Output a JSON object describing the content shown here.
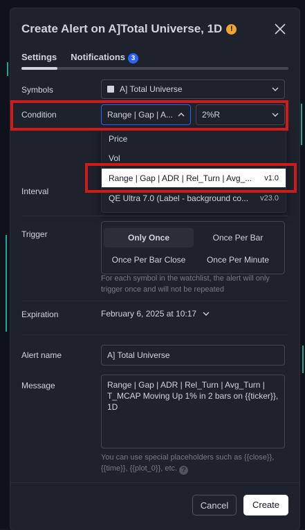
{
  "dialog": {
    "title": "Create Alert on A]Total Universe, 1D",
    "warning_icon": "!"
  },
  "tabs": [
    {
      "label": "Settings",
      "active": true
    },
    {
      "label": "Notifications",
      "badge": "3"
    }
  ],
  "symbols": {
    "label": "Symbols",
    "value": "A] Total Universe"
  },
  "condition": {
    "label": "Condition",
    "value": "Range | Gap | A...",
    "second_value": "2%R"
  },
  "condition_dropdown": {
    "items": [
      {
        "label": "Price"
      },
      {
        "label": "Vol"
      },
      {
        "label": "Range | Gap | ADR | Rel_Turn | Avg_...",
        "version": "v1.0",
        "selected": true
      },
      {
        "label": "QE Ultra 7.0 (Label - background co...",
        "version": "v23.0"
      }
    ]
  },
  "interval": {
    "label": "Interval"
  },
  "trigger": {
    "label": "Trigger",
    "options": [
      "Only Once",
      "Once Per Bar",
      "Once Per Bar Close",
      "Once Per Minute"
    ],
    "selected": "Only Once",
    "hint": "For each symbol in the watchlist, the alert will only trigger once and will not be repeated"
  },
  "expiration": {
    "label": "Expiration",
    "value": "February 6, 2025 at 10:17"
  },
  "alert_name": {
    "label": "Alert name",
    "value": "A] Total Universe"
  },
  "message": {
    "label": "Message",
    "value": "Range | Gap | ADR | Rel_Turn | Avg_Turn |\nT_MCAP Moving Up 1% in 2 bars on {{ticker}},\n1D",
    "hint": "You can use special placeholders such as {{close}}, {{time}}, {{plot_0}}, etc."
  },
  "buttons": {
    "cancel": "Cancel",
    "create": "Create"
  },
  "colors": {
    "highlight": "#d11a1a",
    "accent": "#2962ff",
    "warning": "#f0a531"
  }
}
